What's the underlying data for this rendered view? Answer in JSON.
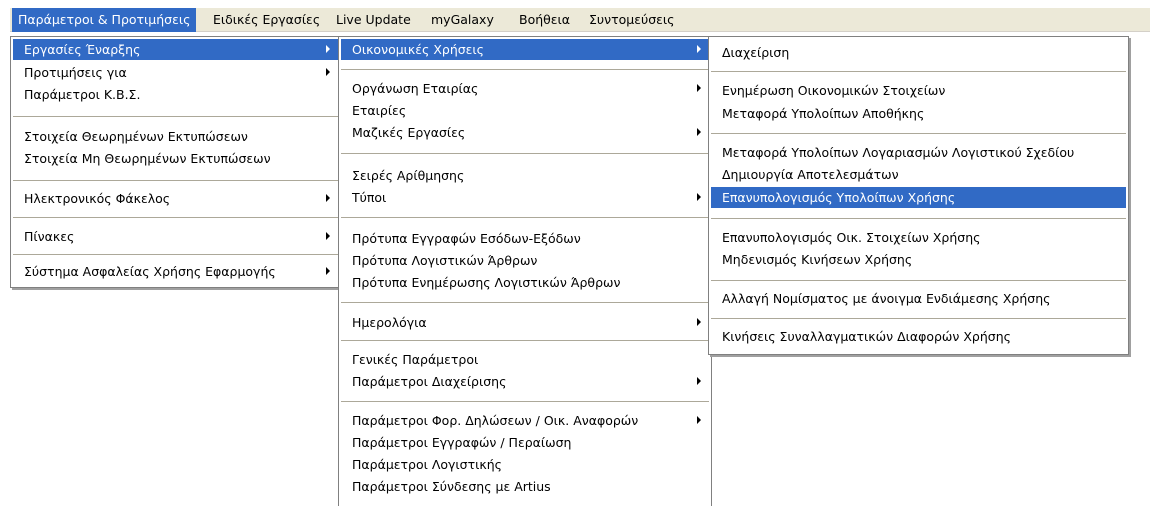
{
  "menubar": {
    "items": [
      {
        "label": "Παράμετροι & Προτιμήσεις"
      },
      {
        "label": "Ειδικές Εργασίες"
      },
      {
        "label": "Live Update"
      },
      {
        "label": "myGalaxy"
      },
      {
        "label": "Βοήθεια"
      },
      {
        "label": "Συντομεύσεις"
      }
    ]
  },
  "menu1": {
    "items": [
      {
        "label": "Εργασίες Έναρξης"
      },
      {
        "label": "Προτιμήσεις για"
      },
      {
        "label": "Παράμετροι Κ.Β.Σ."
      },
      {
        "label": "Στοιχεία Θεωρημένων Εκτυπώσεων"
      },
      {
        "label": "Στοιχεία Μη Θεωρημένων Εκτυπώσεων"
      },
      {
        "label": "Ηλεκτρονικός Φάκελος"
      },
      {
        "label": "Πίνακες"
      },
      {
        "label": "Σύστημα Ασφαλείας Χρήσης Εφαρμογής"
      }
    ]
  },
  "menu2": {
    "items": [
      {
        "label": "Οικονομικές Χρήσεις"
      },
      {
        "label": "Οργάνωση Εταιρίας"
      },
      {
        "label": "Εταιρίες"
      },
      {
        "label": "Μαζικές Εργασίες"
      },
      {
        "label": "Σειρές Αρίθμησης"
      },
      {
        "label": "Τύποι"
      },
      {
        "label": "Πρότυπα Εγγραφών Εσόδων-Εξόδων"
      },
      {
        "label": "Πρότυπα Λογιστικών Άρθρων"
      },
      {
        "label": "Πρότυπα Ενημέρωσης Λογιστικών Άρθρων"
      },
      {
        "label": "Ημερολόγια"
      },
      {
        "label": "Γενικές Παράμετροι"
      },
      {
        "label": "Παράμετροι Διαχείρισης"
      },
      {
        "label": "Παράμετροι Φορ. Δηλώσεων / Οικ. Αναφορών"
      },
      {
        "label": "Παράμετροι Εγγραφών / Περαίωση"
      },
      {
        "label": "Παράμετροι Λογιστικής"
      },
      {
        "label": "Παράμετροι Σύνδεσης με Artius"
      }
    ]
  },
  "menu3": {
    "items": [
      {
        "label": "Διαχείριση"
      },
      {
        "label": "Ενημέρωση Οικονομικών Στοιχείων"
      },
      {
        "label": "Μεταφορά Υπολοίπων Αποθήκης"
      },
      {
        "label": "Μεταφορά Υπολοίπων Λογαριασμών Λογιστικού Σχεδίου"
      },
      {
        "label": "Δημιουργία Αποτελεσμάτων"
      },
      {
        "label": "Επανυπολογισμός Υπολοίπων Χρήσης"
      },
      {
        "label": "Επανυπολογισμός Οικ. Στοιχείων Χρήσης"
      },
      {
        "label": "Μηδενισμός Κινήσεων Χρήσης"
      },
      {
        "label": "Αλλαγή Νομίσματος με άνοιγμα Ενδιάμεσης Χρήσης"
      },
      {
        "label": "Κινήσεις Συναλλαγματικών Διαφορών Χρήσης"
      }
    ]
  },
  "colors": {
    "highlight": "#316ac5",
    "menubar": "#ece9d8"
  }
}
